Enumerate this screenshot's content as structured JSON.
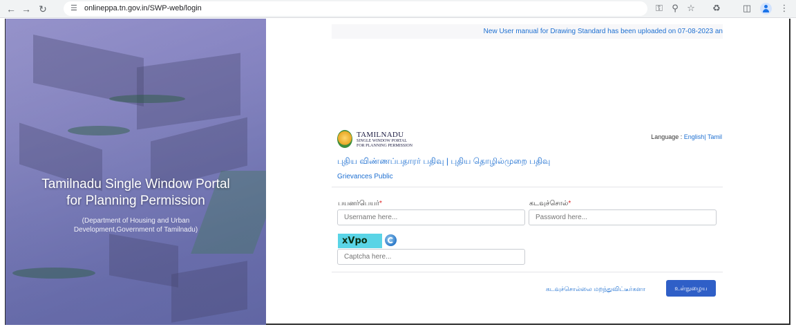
{
  "browser": {
    "url": "onlineppa.tn.gov.in/SWP-web/login",
    "back_icon": "arrow-left-icon",
    "forward_icon": "arrow-right-icon",
    "reload_icon": "reload-icon",
    "site_info_icon": "tune-icon",
    "toolbar_icons": [
      "password-key-icon",
      "zoom-icon",
      "star-icon",
      "extensions-icon",
      "sidepanel-icon",
      "profile-icon",
      "more-icon"
    ]
  },
  "hero": {
    "title_line1": "Tamilnadu Single Window Portal",
    "title_line2": "for Planning Permission",
    "subtitle_line1": "(Department of Housing and Urban",
    "subtitle_line2": "Development,Government of Tamilnadu)"
  },
  "notice": {
    "text": "New User manual for Drawing Standard has been uploaded on 07-08-2023 an"
  },
  "logo": {
    "main": "TAMILNADU",
    "sub_line1": "SINGLE WINDOW PORTAL",
    "sub_line2": "FOR PLANNING PERMISSION"
  },
  "language": {
    "label": "Language :",
    "english": "English|",
    "tamil": "Tamil"
  },
  "registration": {
    "new_applicant": "புதிய விண்ணப்பதாரர் பதிவு",
    "separator": "|",
    "new_professional": "புதிய தொழில்முறை பதிவு"
  },
  "grievances": "Grievances Public",
  "form": {
    "username_label": "பயனர்பெயர்",
    "username_placeholder": "Username here...",
    "password_label": "கடவுச்சொல்",
    "password_placeholder": "Password here...",
    "required_marker": "*",
    "captcha_text": "xVpo",
    "captcha_placeholder": "Captcha here...",
    "forgot_password": "கடவுச்சொல்லை மறந்துவிட்டீர்களா",
    "login_button": "உள்நுழைய"
  }
}
